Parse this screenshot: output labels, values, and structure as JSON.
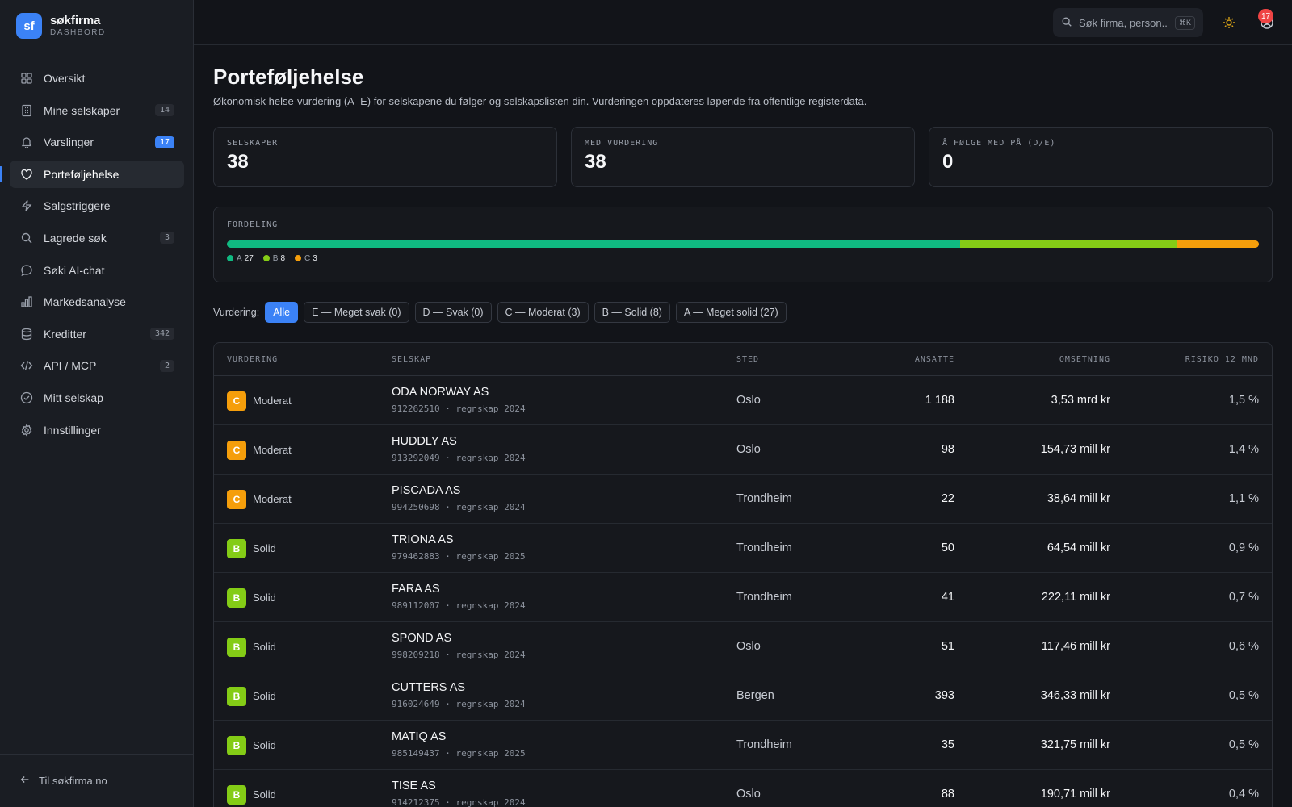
{
  "brand": {
    "logo": "sf",
    "name": "søkfirma",
    "subtitle": "DASHBORD"
  },
  "nav": [
    {
      "id": "oversikt",
      "label": "Oversikt",
      "icon": "grid-icon",
      "count": null
    },
    {
      "id": "mine-selskaper",
      "label": "Mine selskaper",
      "icon": "building-icon",
      "count": "14"
    },
    {
      "id": "varslinger",
      "label": "Varslinger",
      "icon": "bell-icon",
      "count": "17",
      "highlight": true
    },
    {
      "id": "portefoljehelse",
      "label": "Porteføljehelse",
      "icon": "heart-icon",
      "count": null,
      "active": true
    },
    {
      "id": "salgstriggere",
      "label": "Salgstriggere",
      "icon": "bolt-icon",
      "count": null
    },
    {
      "id": "lagrede-sok",
      "label": "Lagrede søk",
      "icon": "search-icon",
      "count": "3"
    },
    {
      "id": "soki-ai-chat",
      "label": "Søki AI-chat",
      "icon": "chat-icon",
      "count": null
    },
    {
      "id": "markedsanalyse",
      "label": "Markedsanalyse",
      "icon": "bar-chart-icon",
      "count": null
    },
    {
      "id": "kreditter",
      "label": "Kreditter",
      "icon": "database-icon",
      "count": "342"
    },
    {
      "id": "api-mcp",
      "label": "API / MCP",
      "icon": "code-icon",
      "count": "2"
    },
    {
      "id": "mitt-selskap",
      "label": "Mitt selskap",
      "icon": "check-circle-icon",
      "count": null
    },
    {
      "id": "innstillinger",
      "label": "Innstillinger",
      "icon": "gear-icon",
      "count": null
    }
  ],
  "footer": {
    "back_label": "Til søkfirma.no"
  },
  "topbar": {
    "search_placeholder": "Søk firma, person...",
    "search_shortcut": "⌘K",
    "notification_count": "17"
  },
  "page": {
    "title": "Porteføljehelse",
    "description": "Økonomisk helse-vurdering (A–E) for selskapene du følger og selskapslisten din. Vurderingen oppdateres løpende fra offentlige registerdata."
  },
  "stats": [
    {
      "label": "SELSKAPER",
      "value": "38"
    },
    {
      "label": "MED VURDERING",
      "value": "38"
    },
    {
      "label": "Å FØLGE MED PÅ (D/E)",
      "value": "0"
    }
  ],
  "distribution": {
    "label": "FORDELING",
    "segments": [
      {
        "grade": "A",
        "count": 27,
        "color": "#10b981"
      },
      {
        "grade": "B",
        "count": 8,
        "color": "#84cc16"
      },
      {
        "grade": "C",
        "count": 3,
        "color": "#f59e0b"
      }
    ]
  },
  "filters": {
    "label": "Vurdering:",
    "options": [
      {
        "label": "Alle",
        "active": true
      },
      {
        "label": "E — Meget svak (0)"
      },
      {
        "label": "D — Svak (0)"
      },
      {
        "label": "C — Moderat (3)"
      },
      {
        "label": "B — Solid (8)"
      },
      {
        "label": "A — Meget solid (27)"
      }
    ]
  },
  "table": {
    "headers": {
      "rating": "VURDERING",
      "company": "SELSKAP",
      "city": "STED",
      "employees": "ANSATTE",
      "revenue": "OMSETNING",
      "risk": "RISIKO 12 MND"
    },
    "rows": [
      {
        "grade": "C",
        "grade_label": "Moderat",
        "color": "#f59e0b",
        "name": "ODA NORWAY AS",
        "meta": "912262510 · regnskap 2024",
        "city": "Oslo",
        "employees": "1 188",
        "revenue": "3,53 mrd kr",
        "risk": "1,5 %"
      },
      {
        "grade": "C",
        "grade_label": "Moderat",
        "color": "#f59e0b",
        "name": "HUDDLY AS",
        "meta": "913292049 · regnskap 2024",
        "city": "Oslo",
        "employees": "98",
        "revenue": "154,73 mill kr",
        "risk": "1,4 %"
      },
      {
        "grade": "C",
        "grade_label": "Moderat",
        "color": "#f59e0b",
        "name": "PISCADA AS",
        "meta": "994250698 · regnskap 2024",
        "city": "Trondheim",
        "employees": "22",
        "revenue": "38,64 mill kr",
        "risk": "1,1 %"
      },
      {
        "grade": "B",
        "grade_label": "Solid",
        "color": "#84cc16",
        "name": "TRIONA AS",
        "meta": "979462883 · regnskap 2025",
        "city": "Trondheim",
        "employees": "50",
        "revenue": "64,54 mill kr",
        "risk": "0,9 %"
      },
      {
        "grade": "B",
        "grade_label": "Solid",
        "color": "#84cc16",
        "name": "FARA AS",
        "meta": "989112007 · regnskap 2024",
        "city": "Trondheim",
        "employees": "41",
        "revenue": "222,11 mill kr",
        "risk": "0,7 %"
      },
      {
        "grade": "B",
        "grade_label": "Solid",
        "color": "#84cc16",
        "name": "SPOND AS",
        "meta": "998209218 · regnskap 2024",
        "city": "Oslo",
        "employees": "51",
        "revenue": "117,46 mill kr",
        "risk": "0,6 %"
      },
      {
        "grade": "B",
        "grade_label": "Solid",
        "color": "#84cc16",
        "name": "CUTTERS AS",
        "meta": "916024649 · regnskap 2024",
        "city": "Bergen",
        "employees": "393",
        "revenue": "346,33 mill kr",
        "risk": "0,5 %"
      },
      {
        "grade": "B",
        "grade_label": "Solid",
        "color": "#84cc16",
        "name": "MATIQ AS",
        "meta": "985149437 · regnskap 2025",
        "city": "Trondheim",
        "employees": "35",
        "revenue": "321,75 mill kr",
        "risk": "0,5 %"
      },
      {
        "grade": "B",
        "grade_label": "Solid",
        "color": "#84cc16",
        "name": "TISE AS",
        "meta": "914212375 · regnskap 2024",
        "city": "Oslo",
        "employees": "88",
        "revenue": "190,71 mill kr",
        "risk": "0,4 %"
      }
    ]
  }
}
